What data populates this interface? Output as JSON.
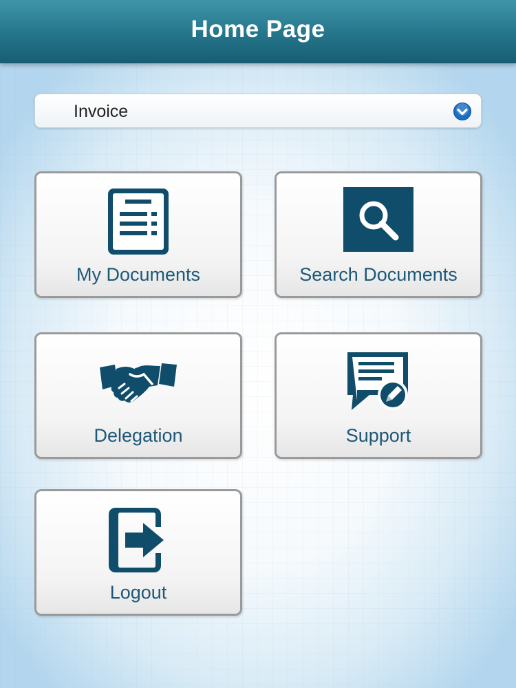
{
  "header": {
    "title": "Home Page"
  },
  "selector": {
    "value": "Invoice",
    "icon": "chevron-down-circle-icon",
    "accent": "#1a6ec3"
  },
  "tiles": [
    {
      "label": "My Documents",
      "icon": "document-icon"
    },
    {
      "label": "Search Documents",
      "icon": "magnifier-icon"
    },
    {
      "label": "Delegation",
      "icon": "handshake-icon"
    },
    {
      "label": "Support",
      "icon": "support-chat-edit-icon"
    },
    {
      "label": "Logout",
      "icon": "logout-arrow-icon"
    }
  ],
  "colors": {
    "header": "#24758b",
    "icon": "#0f4d6b",
    "label": "#1d5877"
  }
}
